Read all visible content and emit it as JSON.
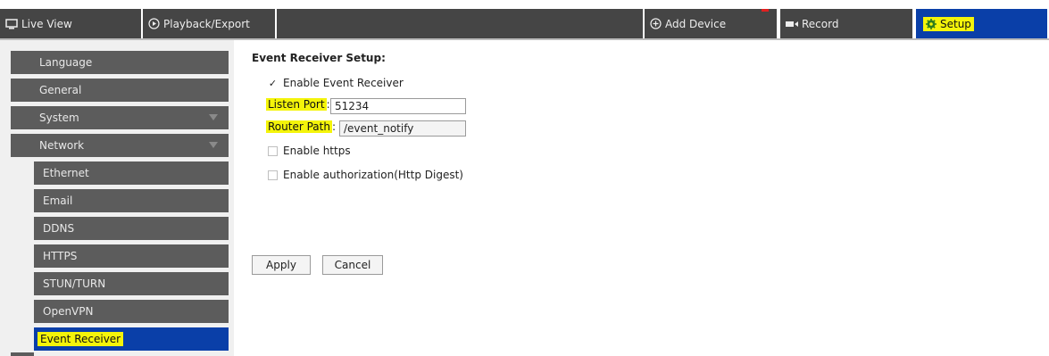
{
  "topbar": {
    "tabs": [
      {
        "label": "Live View",
        "icon": "monitor-icon"
      },
      {
        "label": "Playback/Export",
        "icon": "play-circle-icon"
      }
    ],
    "add_device": {
      "label": "Add Device",
      "icon": "plus-circle-icon"
    },
    "record": {
      "label": "Record",
      "icon": "video-camera-icon"
    },
    "setup": {
      "label": "Setup",
      "icon": "gear-icon"
    }
  },
  "sidebar": {
    "items": [
      {
        "label": "Language"
      },
      {
        "label": "General"
      },
      {
        "label": "System",
        "expandable": true
      },
      {
        "label": "Network",
        "expandable": true
      },
      {
        "label": "Ethernet"
      },
      {
        "label": "Email"
      },
      {
        "label": "DDNS"
      },
      {
        "label": "HTTPS"
      },
      {
        "label": "STUN/TURN"
      },
      {
        "label": "OpenVPN"
      },
      {
        "label": "Event Receiver",
        "active": true
      }
    ]
  },
  "form": {
    "title": "Event Receiver Setup:",
    "enable_receiver": {
      "label": "Enable Event Receiver",
      "checked": true
    },
    "listen_port": {
      "label": "Listen Port",
      "value": "51234"
    },
    "router_path": {
      "label": "Router Path",
      "value": "/event_notify"
    },
    "enable_https": {
      "label": "Enable https",
      "checked": false
    },
    "enable_auth": {
      "label": "Enable authorization(Http Digest)",
      "checked": false
    },
    "apply_label": "Apply",
    "cancel_label": "Cancel"
  },
  "colors": {
    "tab_bg": "#454545",
    "active_bg": "#0a3fa8",
    "highlight": "#f4f40a",
    "sidebar_item_bg": "#5c5c5c"
  }
}
